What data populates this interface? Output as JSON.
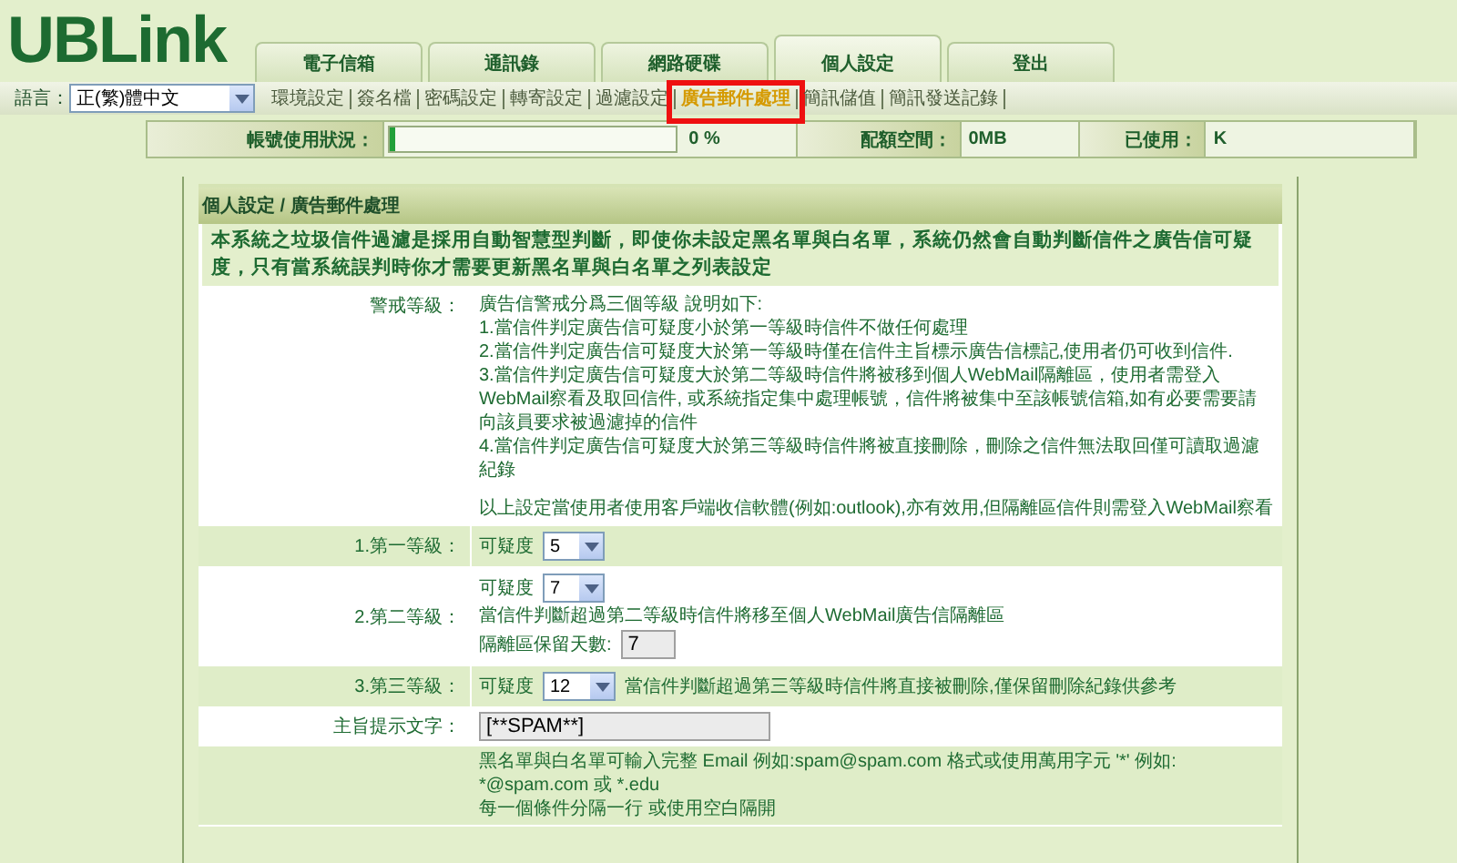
{
  "logo": "UBLink",
  "language": {
    "label": "語言：",
    "value": "正(繁)體中文"
  },
  "tabs": [
    {
      "label": "電子信箱",
      "selected": false
    },
    {
      "label": "通訊錄",
      "selected": false
    },
    {
      "label": "網路硬碟",
      "selected": false
    },
    {
      "label": "個人設定",
      "selected": true
    },
    {
      "label": "登出",
      "selected": false
    }
  ],
  "submenu": [
    {
      "label": "環境設定",
      "selected": false
    },
    {
      "label": "簽名檔",
      "selected": false
    },
    {
      "label": "密碼設定",
      "selected": false
    },
    {
      "label": "轉寄設定",
      "selected": false
    },
    {
      "label": "過濾設定",
      "selected": false
    },
    {
      "label": "廣告郵件處理",
      "selected": true
    },
    {
      "label": "簡訊儲值",
      "selected": false
    },
    {
      "label": "簡訊發送記錄",
      "selected": false
    }
  ],
  "status": {
    "usage_label": "帳號使用狀況：",
    "level": 0.01,
    "percent": "0 %",
    "quota_label": "配額空間：",
    "quota": "0MB",
    "used_label": "已使用：",
    "used": "K"
  },
  "breadcrumb": "個人設定 / 廣告郵件處理",
  "intro": "本系統之垃圾信件過濾是採用自動智慧型判斷，即使你未設定黑名單與白名單，系統仍然會自動判斷信件之廣告信可疑度，只有當系統誤判時你才需要更新黑名單與白名單之列表設定",
  "warning": {
    "label": "警戒等級：",
    "lines": [
      "廣告信警戒分爲三個等級 說明如下:",
      "1.當信件判定廣告信可疑度小於第一等級時信件不做任何處理",
      "2.當信件判定廣告信可疑度大於第一等級時僅在信件主旨標示廣告信標記,使用者仍可收到信件.",
      "3.當信件判定廣告信可疑度大於第二等級時信件將被移到個人WebMail隔離區，使用者需登入WebMail察看及取回信件, 或系統指定集中處理帳號，信件將被集中至該帳號信箱,如有必要需要請向該員要求被過濾掉的信件",
      "4.當信件判定廣告信可疑度大於第三等級時信件將被直接刪除，刪除之信件無法取回僅可讀取過濾紀錄"
    ],
    "note": "以上設定當使用者使用客戶端收信軟體(例如:outlook),亦有效用,但隔離區信件則需登入WebMail察看"
  },
  "levels": [
    {
      "kind": "inline",
      "label": "1.第一等級：",
      "score_label": "可疑度",
      "score": "5"
    },
    {
      "kind": "stacked",
      "label": "2.第二等級：",
      "score_label": "可疑度",
      "score": "7",
      "note": "當信件判斷超過第二等級時信件將移至個人WebMail廣告信隔離區",
      "days_label": "隔離區保留天數:",
      "days": "7"
    },
    {
      "kind": "inline",
      "label": "3.第三等級：",
      "score_label": "可疑度",
      "score": "12",
      "note": "當信件判斷超過第三等級時信件將直接被刪除,僅保留刪除紀錄供參考"
    }
  ],
  "subject": {
    "label": "主旨提示文字：",
    "value": "[**SPAM**]"
  },
  "lists_help": [
    "黑名單與白名單可輸入完整 Email 例如:spam@spam.com 格式或使用萬用字元 '*' 例如: *@spam.com 或 *.edu",
    "每一個條件分隔一行 或使用空白隔開"
  ]
}
